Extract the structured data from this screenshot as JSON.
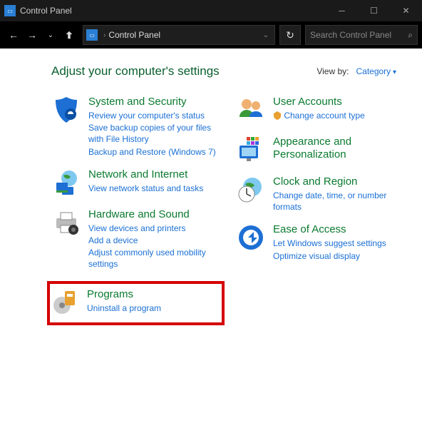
{
  "window": {
    "title": "Control Panel"
  },
  "address": {
    "location": "Control Panel"
  },
  "search": {
    "placeholder": "Search Control Panel"
  },
  "page": {
    "heading": "Adjust your computer's settings",
    "viewby_label": "View by:",
    "viewby_value": "Category"
  },
  "left": [
    {
      "title": "System and Security",
      "links": [
        "Review your computer's status",
        "Save backup copies of your files with File History",
        "Backup and Restore (Windows 7)"
      ]
    },
    {
      "title": "Network and Internet",
      "links": [
        "View network status and tasks"
      ]
    },
    {
      "title": "Hardware and Sound",
      "links": [
        "View devices and printers",
        "Add a device",
        "Adjust commonly used mobility settings"
      ]
    },
    {
      "title": "Programs",
      "links": [
        "Uninstall a program"
      ]
    }
  ],
  "right": [
    {
      "title": "User Accounts",
      "links": [
        "Change account type"
      ]
    },
    {
      "title": "Appearance and Personalization",
      "links": []
    },
    {
      "title": "Clock and Region",
      "links": [
        "Change date, time, or number formats"
      ]
    },
    {
      "title": "Ease of Access",
      "links": [
        "Let Windows suggest settings",
        "Optimize visual display"
      ]
    }
  ]
}
